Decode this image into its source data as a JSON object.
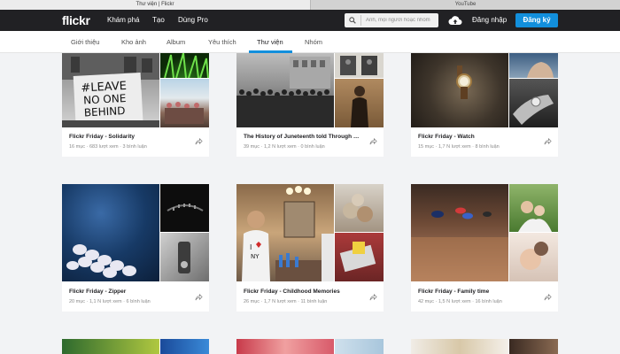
{
  "browser": {
    "tabs": [
      "Thư viện | Flickr",
      "YouTube"
    ]
  },
  "header": {
    "logo": "flickr",
    "nav": [
      "Khám phá",
      "Tạo",
      "Dùng Pro"
    ],
    "search_placeholder": "Ảnh, mọi người hoặc nhóm",
    "login": "Đăng nhập",
    "signup": "Đăng ký"
  },
  "subnav": {
    "items": [
      "Giới thiệu",
      "Kho ảnh",
      "Album",
      "Yêu thích",
      "Thư viện",
      "Nhóm"
    ],
    "active": "Thư viện"
  },
  "colors": {
    "accent": "#128fdc",
    "topbar": "#212124"
  },
  "galleries": [
    {
      "title": "Flickr Friday - Solidarity",
      "items": "16 mục",
      "views": "683 lượt xem",
      "comments": "3 bình luận"
    },
    {
      "title": "The History of Juneteenth told Through Photographs",
      "items": "39 mục",
      "views": "1,2 N lượt xem",
      "comments": "0 bình luận"
    },
    {
      "title": "Flickr Friday - Watch",
      "items": "15 mục",
      "views": "1,7 N lượt xem",
      "comments": "8 bình luận"
    },
    {
      "title": "Flickr Friday - Zipper",
      "items": "20 mục",
      "views": "1,1 N lượt xem",
      "comments": "6 bình luận"
    },
    {
      "title": "Flickr Friday - Childhood Memories",
      "items": "26 mục",
      "views": "1,7 N lượt xem",
      "comments": "11 bình luận"
    },
    {
      "title": "Flickr Friday - Family time",
      "items": "42 mục",
      "views": "1,5 N lượt xem",
      "comments": "16 bình luận"
    }
  ],
  "icons": [
    "search-icon",
    "upload-cloud-icon",
    "share-icon"
  ]
}
